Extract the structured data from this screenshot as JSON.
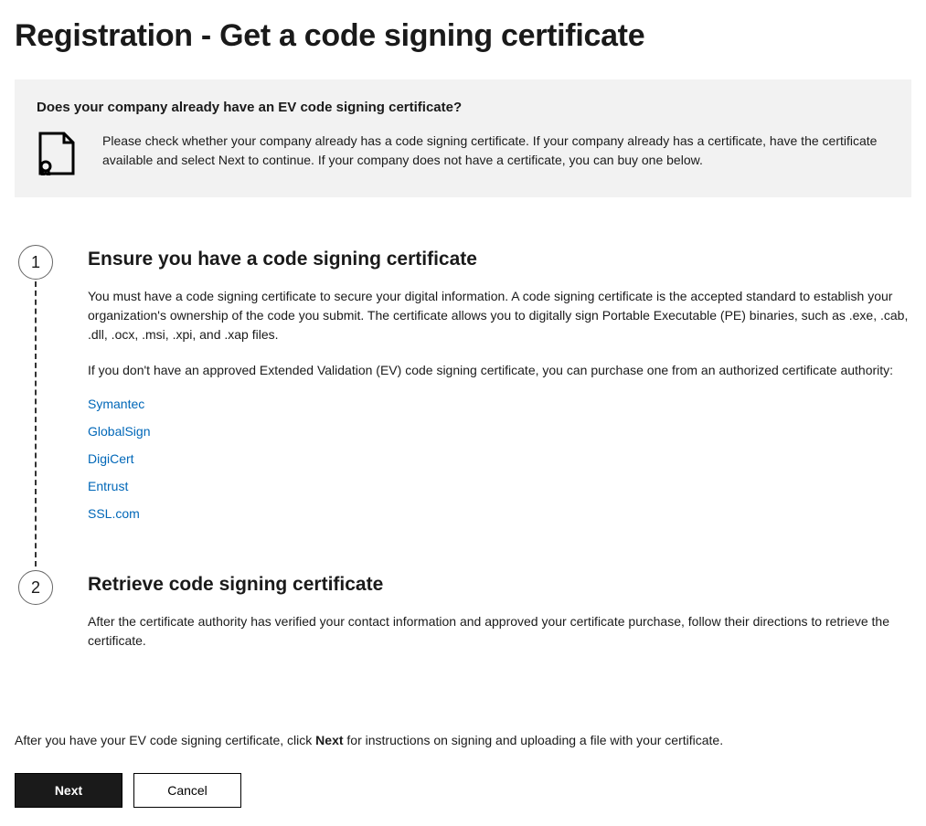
{
  "page_title": "Registration - Get a code signing certificate",
  "info_box": {
    "title": "Does your company already have an EV code signing certificate?",
    "text": "Please check whether your company already has a code signing certificate. If your company already has a certificate, have the certificate available and select Next to continue. If your company does not have a certificate, you can buy one below."
  },
  "step1": {
    "number": "1",
    "title": "Ensure you have a code signing certificate",
    "para1": "You must have a code signing certificate to secure your digital information. A code signing certificate is the accepted standard to establish your organization's ownership of the code you submit. The certificate allows you to digitally sign Portable Executable (PE) binaries, such as .exe, .cab, .dll, .ocx, .msi, .xpi, and .xap files.",
    "para2": "If you don't have an approved Extended Validation (EV) code signing certificate, you can purchase one from an authorized certificate authority:",
    "links": [
      "Symantec",
      "GlobalSign",
      "DigiCert",
      "Entrust",
      "SSL.com"
    ]
  },
  "step2": {
    "number": "2",
    "title": "Retrieve code signing certificate",
    "para1": "After the certificate authority has verified your contact information and approved your certificate purchase, follow their directions to retrieve the certificate."
  },
  "footer": {
    "pre": "After you have your EV code signing certificate, click ",
    "bold": "Next",
    "post": " for instructions on signing and uploading a file with your certificate."
  },
  "buttons": {
    "next": "Next",
    "cancel": "Cancel"
  }
}
